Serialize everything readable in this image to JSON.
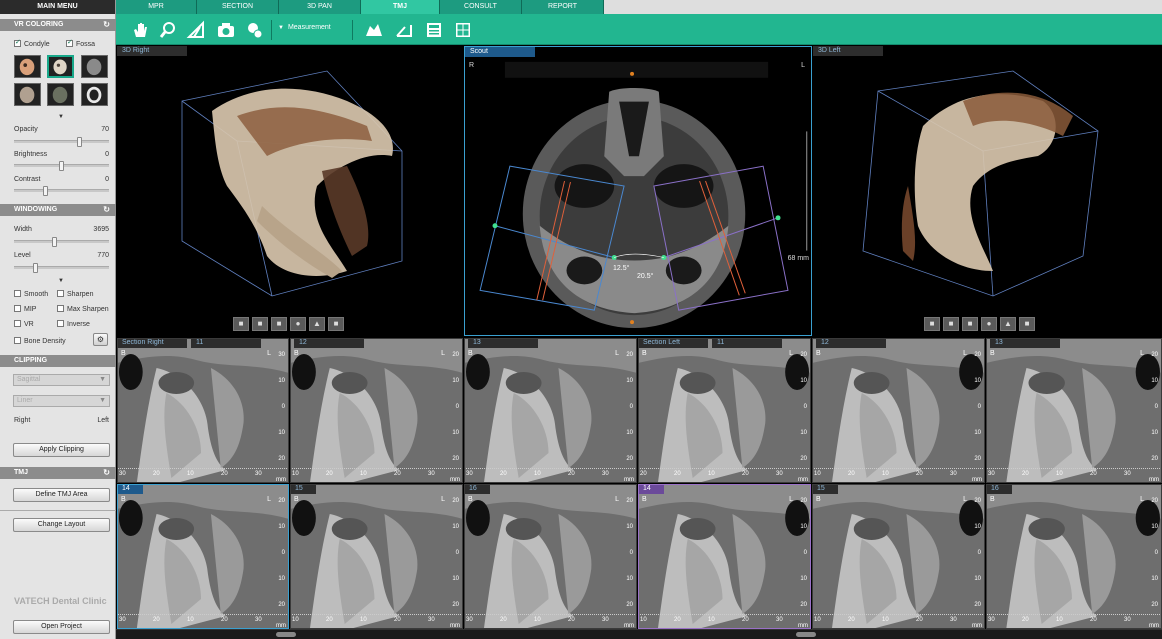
{
  "sidebar": {
    "main_menu": "MAIN MENU",
    "vr_coloring": {
      "title": "VR COLORING",
      "condyle_label": "Condyle",
      "fossa_label": "Fossa",
      "opacity_label": "Opacity",
      "opacity_value": "70",
      "brightness_label": "Brightness",
      "brightness_value": "0",
      "contrast_label": "Contrast",
      "contrast_value": "0"
    },
    "windowing": {
      "title": "WINDOWING",
      "width_label": "Width",
      "width_value": "3695",
      "level_label": "Level",
      "level_value": "770",
      "checks": [
        "Smooth",
        "Sharpen",
        "MIP",
        "Max Sharpen",
        "VR",
        "Inverse",
        "Bone Density"
      ]
    },
    "clipping": {
      "title": "CLIPPING",
      "combo1": "Sagittal",
      "combo2": "Liner",
      "right_label": "Right",
      "left_label": "Left",
      "apply_button": "Apply Clipping"
    },
    "tmj": {
      "title": "TMJ",
      "define_button": "Define TMJ Area",
      "change_layout_button": "Change Layout"
    },
    "brand": "VATECH Dental Clinic",
    "open_project_button": "Open Project"
  },
  "tabs": [
    "MPR",
    "SECTION",
    "3D PAN",
    "TMJ",
    "CONSULT",
    "REPORT"
  ],
  "active_tab": "TMJ",
  "toolbar": {
    "measurement_label": "Measurement"
  },
  "viewports": {
    "right3d": {
      "label": "3D Right"
    },
    "scout": {
      "label": "Scout",
      "r": "R",
      "l": "L",
      "angle1": "12.5°",
      "angle2": "20.5°",
      "mm": "68 mm"
    },
    "left3d": {
      "label": "3D Left"
    }
  },
  "tiles_row1": [
    {
      "label": "Section Right",
      "num": "11",
      "scale": [
        "30",
        "10",
        "0",
        "10",
        "20"
      ],
      "ruler": [
        "30",
        "20",
        "10",
        "20",
        "30"
      ]
    },
    {
      "label": "",
      "num": "12",
      "scale": [
        "20",
        "10",
        "0",
        "10",
        "20"
      ],
      "ruler": [
        "10",
        "20",
        "10",
        "20",
        "30"
      ]
    },
    {
      "label": "",
      "num": "13",
      "scale": [
        "20",
        "10",
        "0",
        "10",
        "20"
      ],
      "ruler": [
        "30",
        "20",
        "10",
        "20",
        "30"
      ]
    },
    {
      "label": "Section Left",
      "num": "11",
      "scale": [
        "20",
        "10",
        "0",
        "10",
        "20"
      ],
      "ruler": [
        "20",
        "20",
        "10",
        "20",
        "30"
      ]
    },
    {
      "label": "",
      "num": "12",
      "scale": [
        "20",
        "10",
        "0",
        "10",
        "20"
      ],
      "ruler": [
        "10",
        "20",
        "10",
        "20",
        "30"
      ]
    },
    {
      "label": "",
      "num": "13",
      "scale": [
        "20",
        "10",
        "0",
        "10",
        "20"
      ],
      "ruler": [
        "30",
        "20",
        "10",
        "20",
        "30"
      ]
    }
  ],
  "tiles_row2": [
    {
      "label": "14",
      "num": "",
      "scale": [
        "20",
        "10",
        "0",
        "10",
        "20"
      ],
      "ruler": [
        "30",
        "20",
        "10",
        "20",
        "30"
      ]
    },
    {
      "label": "15",
      "num": "",
      "scale": [
        "20",
        "10",
        "0",
        "10",
        "20"
      ],
      "ruler": [
        "10",
        "20",
        "10",
        "20",
        "30"
      ]
    },
    {
      "label": "16",
      "num": "",
      "scale": [
        "20",
        "10",
        "0",
        "10",
        "20"
      ],
      "ruler": [
        "30",
        "20",
        "10",
        "20",
        "30"
      ]
    },
    {
      "label": "14",
      "num": "",
      "scale": [
        "20",
        "10",
        "0",
        "10",
        "20"
      ],
      "ruler": [
        "10",
        "20",
        "10",
        "20",
        "30"
      ]
    },
    {
      "label": "15",
      "num": "",
      "scale": [
        "20",
        "10",
        "0",
        "10",
        "20"
      ],
      "ruler": [
        "10",
        "20",
        "10",
        "20",
        "30"
      ]
    },
    {
      "label": "16",
      "num": "",
      "scale": [
        "20",
        "10",
        "0",
        "10",
        "20"
      ],
      "ruler": [
        "30",
        "20",
        "10",
        "20",
        "30"
      ]
    }
  ],
  "tile_orient": {
    "b": "B",
    "l": "L",
    "mm": "mm"
  },
  "colors": {
    "accent": "#22b690",
    "tab_active": "#31c7a2",
    "selected_blue": "#3aa0d0",
    "selected_purple": "#9a70c8"
  }
}
